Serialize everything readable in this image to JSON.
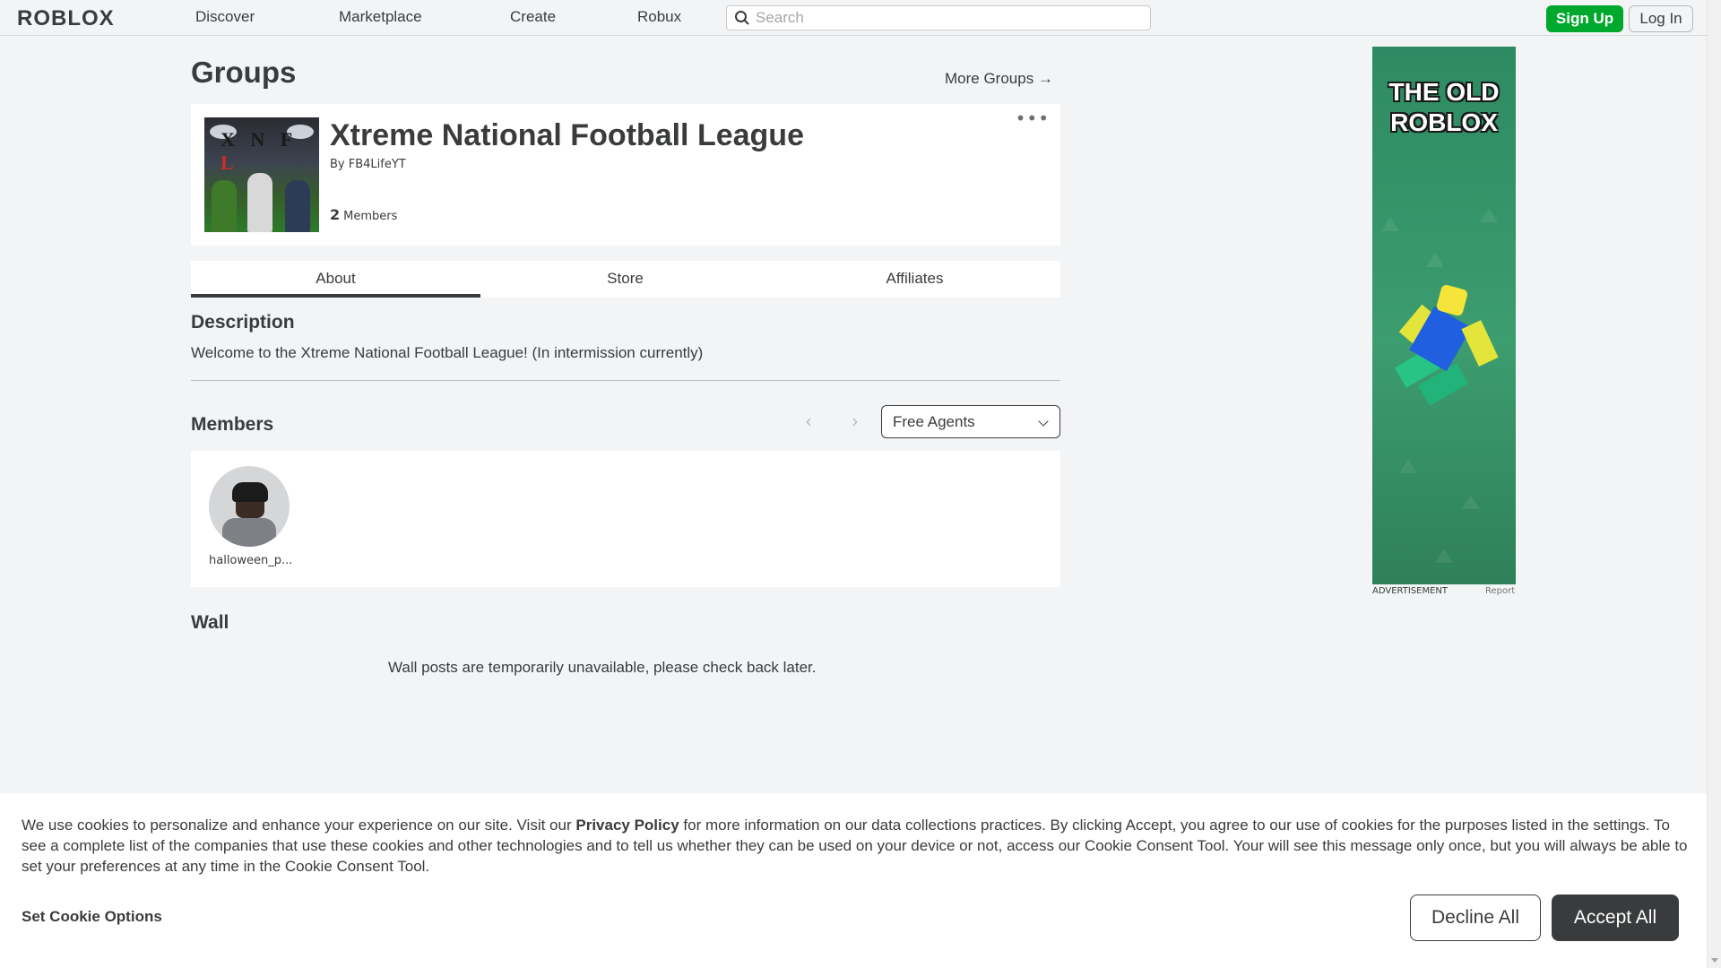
{
  "nav": {
    "logo": "ROBLOX",
    "links": [
      "Discover",
      "Marketplace",
      "Create",
      "Robux"
    ],
    "search_placeholder": "Search",
    "signup": "Sign Up",
    "login": "Log In"
  },
  "page": {
    "title": "Groups",
    "more_groups": "More Groups →"
  },
  "group": {
    "name": "Xtreme National Football League",
    "by_label": "By",
    "owner": "FB4LifeYT",
    "member_count": "2",
    "members_label": "Members",
    "thumb_text": "XNFL"
  },
  "tabs": [
    "About",
    "Store",
    "Affiliates"
  ],
  "about": {
    "description_heading": "Description",
    "description": "Welcome to the Xtreme National Football League! (In intermission currently)",
    "members_heading": "Members",
    "role_selected": "Free Agents",
    "members": [
      {
        "name": "halloween_p..."
      }
    ],
    "wall_heading": "Wall",
    "wall_message": "Wall posts are temporarily unavailable, please check back later."
  },
  "ad": {
    "title": "THE OLD ROBLOX",
    "label": "ADVERTISEMENT",
    "report": "Report"
  },
  "cookie": {
    "text_before": "We use cookies to personalize and enhance your experience on our site. Visit our ",
    "privacy_link": "Privacy Policy",
    "text_after": " for more information on our data collections practices. By clicking Accept, you agree to our use of cookies for the purposes listed in the settings. To see a complete list of the companies that use these cookies and other technologies and to tell us whether they can be used on your device or not, access our Cookie Consent Tool. Your will see this message only once, but you will always be able to set your preferences at any time in the Cookie Consent Tool.",
    "set_options": "Set Cookie Options",
    "decline": "Decline All",
    "accept": "Accept All"
  },
  "colors": {
    "accent_green": "#00a82d",
    "text": "#393b3d",
    "background": "#f2f4f5"
  }
}
